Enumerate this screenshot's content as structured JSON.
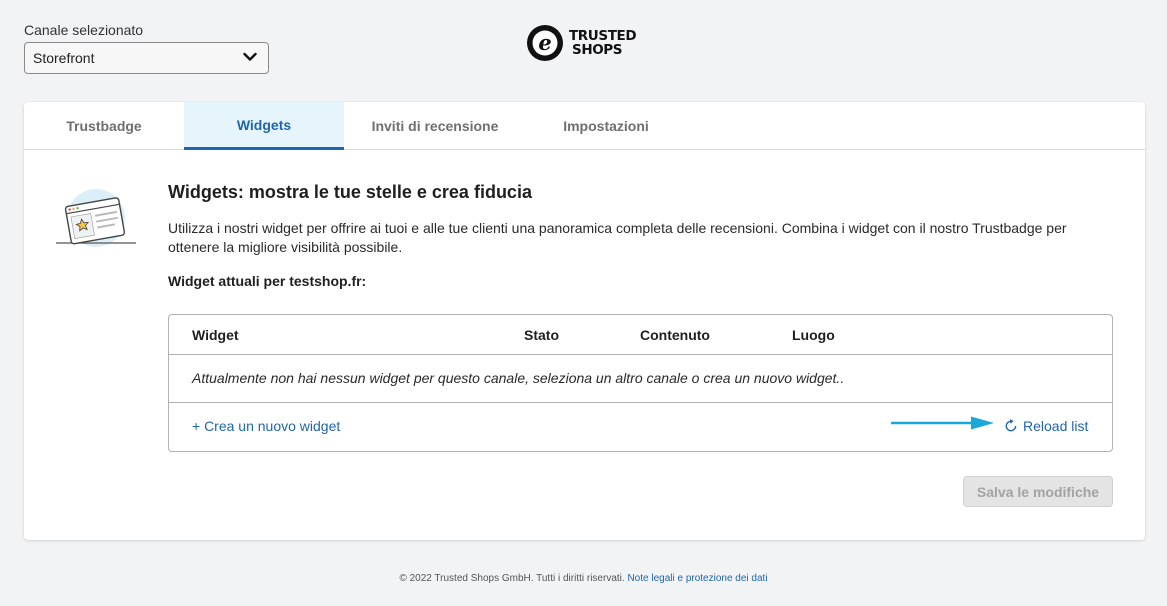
{
  "channel": {
    "label": "Canale selezionato",
    "selected": "Storefront"
  },
  "logo": {
    "line1": "TRUSTED",
    "line2": "SHOPS"
  },
  "tabs": [
    {
      "label": "Trustbadge",
      "active": false
    },
    {
      "label": "Widgets",
      "active": true
    },
    {
      "label": "Inviti di recensione",
      "active": false
    },
    {
      "label": "Impostazioni",
      "active": false
    }
  ],
  "section": {
    "title": "Widgets: mostra le tue stelle e crea fiducia",
    "description": "Utilizza i nostri widget per offrire ai tuoi e alle tue clienti una panoramica completa delle recensioni. Combina i widget con il nostro Trustbadge per ottenere la migliore visibilità possibile.",
    "subheading": "Widget attuali per testshop.fr:"
  },
  "table": {
    "columns": [
      "Widget",
      "Stato",
      "Contenuto",
      "Luogo"
    ],
    "empty_message": "Attualmente non hai nessun widget per questo canale, seleziona un altro canale o crea un nuovo widget..",
    "create_link": "+ Crea un nuovo widget",
    "reload_link": "Reload list"
  },
  "save_button": "Salva le modifiche",
  "footer": {
    "copyright": "© 2022 Trusted Shops GmbH. Tutti i diritti riservati.",
    "legal_link": "Note legali e protezione dei dati"
  },
  "colors": {
    "accent": "#1e66b0",
    "active_tab_bg": "#e6f4fb",
    "arrow": "#1aa9d6"
  },
  "icons": [
    "chevron-down-icon",
    "trusted-shops-logo-icon",
    "widget-illustration-icon",
    "arrow-right-icon",
    "reload-icon"
  ]
}
